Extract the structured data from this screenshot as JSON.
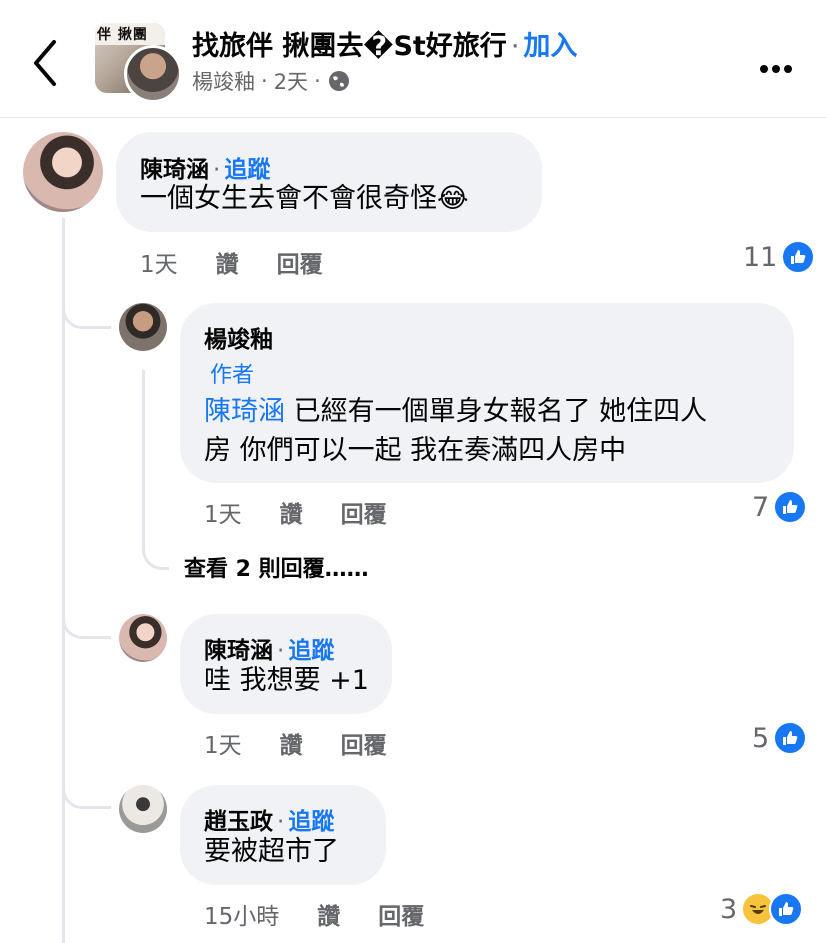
{
  "header": {
    "group_name": "找旅伴 揪團去�St好旅行",
    "separator": "·",
    "join_label": "加入",
    "group_avatar_text": "伴 揪團",
    "poster": "楊竣釉",
    "meta_dot": "·",
    "time": "2天",
    "privacy_icon": "globe-icon"
  },
  "comments": [
    {
      "author": "陳琦涵",
      "separator": "·",
      "follow_label": "追蹤",
      "text": "一個女生去會不會很奇怪",
      "emoji": "😂",
      "time": "1天",
      "like_label": "讚",
      "reply_label": "回覆",
      "reaction_count": "11"
    },
    {
      "author": "楊竣釉",
      "badge": "作者",
      "mention": "陳琦涵",
      "text_line1": " 已經有一個單身女報名了 她住四人",
      "text_line2": "房 你們可以一起 我在奏滿四人房中",
      "time": "1天",
      "like_label": "讚",
      "reply_label": "回覆",
      "reaction_count": "7"
    },
    {
      "author": "陳琦涵",
      "separator": "·",
      "follow_label": "追蹤",
      "text": "哇 我想要 +1",
      "time": "1天",
      "like_label": "讚",
      "reply_label": "回覆",
      "reaction_count": "5"
    },
    {
      "author": "趙玉政",
      "separator": "·",
      "follow_label": "追蹤",
      "text": "要被超市了",
      "time": "15小時",
      "like_label": "讚",
      "reply_label": "回覆",
      "reaction_count": "3"
    }
  ],
  "view_more_replies": "查看 2 則回覆……",
  "colors": {
    "accent": "#1877f2",
    "bubble": "#f0f2f5",
    "muted": "#65676b"
  }
}
